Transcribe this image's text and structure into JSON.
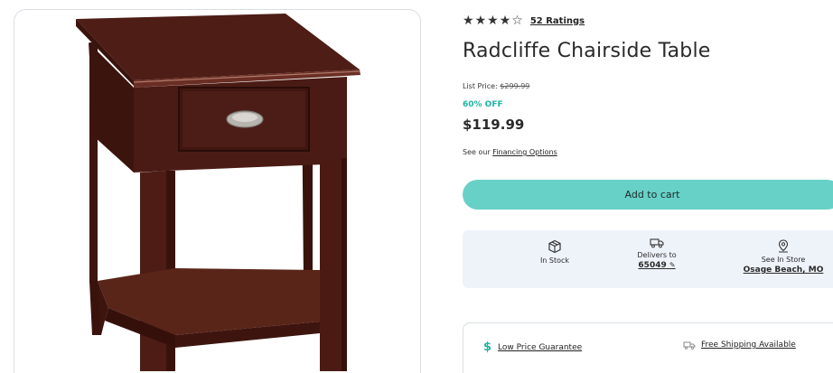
{
  "product": {
    "rating_stars": 4.5,
    "ratings_link": "52 Ratings",
    "title": "Radcliffe Chairside Table",
    "list_price_label": "List Price:",
    "list_price_value": "$299.99",
    "discount": "60% OFF",
    "sale_price": "$119.99",
    "financing_prefix": "See our",
    "financing_link": "Financing Options"
  },
  "cart": {
    "add_label": "Add to cart",
    "button_color": "#67d1c8"
  },
  "fulfillment": {
    "in_stock": {
      "label": "In Stock",
      "icon": "box-icon"
    },
    "delivers": {
      "label": "Delivers to",
      "zip": "65049",
      "icon": "truck-icon",
      "edit_icon": "pencil-icon"
    },
    "store": {
      "label": "See In Store",
      "location": "Osage Beach, MO",
      "icon": "location-pin-icon"
    }
  },
  "guarantees": {
    "low_price": {
      "label": "Low Price Guarantee",
      "icon": "dollar-icon"
    },
    "shipping": {
      "label": "Free Shipping Available",
      "icon": "truck-icon"
    }
  },
  "colors": {
    "accent": "#1fb3a4",
    "wood": "#4a1c14",
    "panel": "#eef3fa"
  }
}
